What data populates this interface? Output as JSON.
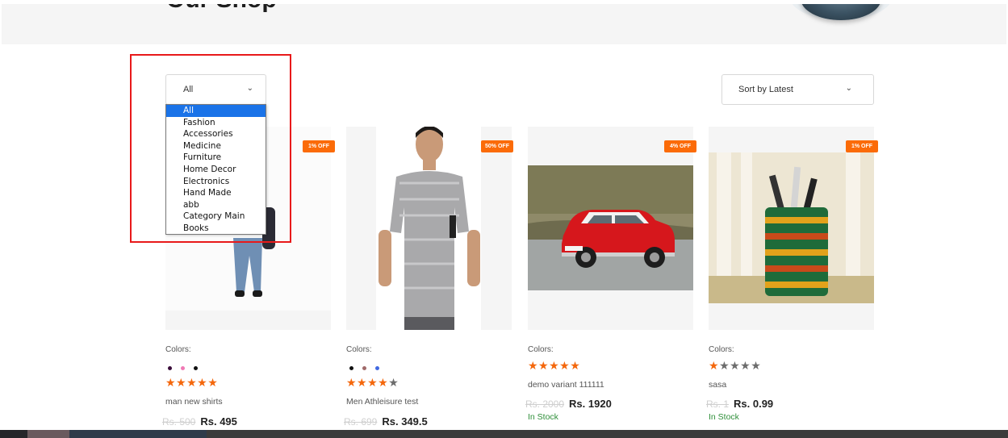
{
  "hero": {
    "title": "Our Shop"
  },
  "filters": {
    "category_selected": "All",
    "category_options": [
      "All",
      "Fashion",
      "Accessories",
      "Medicine",
      "Furniture",
      "Home Decor",
      "Electronics",
      "Hand Made",
      "abb",
      "Category Main",
      "Books"
    ],
    "sort_label": "Sort by Latest"
  },
  "colors": {
    "accent": "#f4670c",
    "badge": "#fb6b08",
    "in_stock": "#2f8f3a",
    "selected_option": "#1a73e8",
    "highlight": "#e8191a"
  },
  "products": [
    {
      "badge": "1% OFF",
      "colors_label": "Colors:",
      "swatches": [
        "#3a0d3a",
        "#f07ab5",
        "#111111"
      ],
      "rating": 5,
      "stars": "★★★★★",
      "stars_off": "",
      "name": "man new shirts",
      "old_price": "Rs. 500",
      "price": "Rs. 495",
      "stock": ""
    },
    {
      "badge": "50% OFF",
      "colors_label": "Colors:",
      "swatches": [
        "#111111",
        "#a06a6a",
        "#4169e1"
      ],
      "rating": 4,
      "stars": "★★★★",
      "stars_off": "★",
      "name": "Men Athleisure test",
      "old_price": "Rs. 699",
      "price": "Rs. 349.5",
      "stock": ""
    },
    {
      "badge": "4% OFF",
      "colors_label": "Colors:",
      "swatches": [],
      "rating": 5,
      "stars": "★★★★★",
      "stars_off": "",
      "name": "demo variant 111111",
      "old_price": "Rs. 2000",
      "price": "Rs. 1920",
      "stock": "In Stock"
    },
    {
      "badge": "1% OFF",
      "colors_label": "Colors:",
      "swatches": [],
      "rating": 1,
      "stars": "★",
      "stars_off": "★★★★",
      "name": "sasa",
      "old_price": "Rs. 1",
      "price": "Rs. 0.99",
      "stock": "In Stock"
    }
  ]
}
